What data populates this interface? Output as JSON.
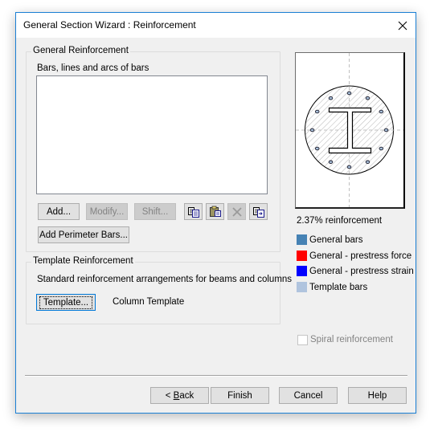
{
  "window": {
    "title": "General Section Wizard : Reinforcement",
    "close_icon": "close-icon"
  },
  "general_reinforcement": {
    "group_label": "General Reinforcement",
    "list_label": "Bars, lines and arcs of bars",
    "list_items": [],
    "buttons": {
      "add": "Add...",
      "modify": "Modify...",
      "shift": "Shift...",
      "add_perimeter": "Add Perimeter Bars..."
    },
    "button_states": {
      "add": "enabled",
      "modify": "disabled",
      "shift": "disabled"
    },
    "icon_buttons": [
      {
        "icon": "copy-icon",
        "enabled": true
      },
      {
        "icon": "paste-icon",
        "enabled": true
      },
      {
        "icon": "delete-icon",
        "enabled": false
      },
      {
        "icon": "duplicate-icon",
        "enabled": true
      }
    ]
  },
  "template_reinforcement": {
    "group_label": "Template Reinforcement",
    "description": "Standard reinforcement arrangements for beams and columns",
    "template_button": "Template...",
    "current_template": "Column Template"
  },
  "preview": {
    "section_shape": "circular",
    "steel_section": "I-section",
    "bar_count": 12,
    "reinforcement_ratio": "2.37% reinforcement"
  },
  "legend": [
    {
      "label": "General bars",
      "color": "#4682b4"
    },
    {
      "label": "General - prestress force",
      "color": "#ff0000"
    },
    {
      "label": "General - prestress strain",
      "color": "#0000ff"
    },
    {
      "label": "Template bars",
      "color": "#b0c4de"
    }
  ],
  "spiral": {
    "label": "Spiral reinforcement",
    "checked": false,
    "enabled": false
  },
  "footer": {
    "back_prefix": "< ",
    "back_mnemonic": "B",
    "back_rest": "ack",
    "finish": "Finish",
    "cancel": "Cancel",
    "help": "Help"
  },
  "colors": {
    "accent": "#1a7fd4",
    "dialog_bg": "#f0f0f0",
    "bar_fill": "#a8bfd8"
  }
}
